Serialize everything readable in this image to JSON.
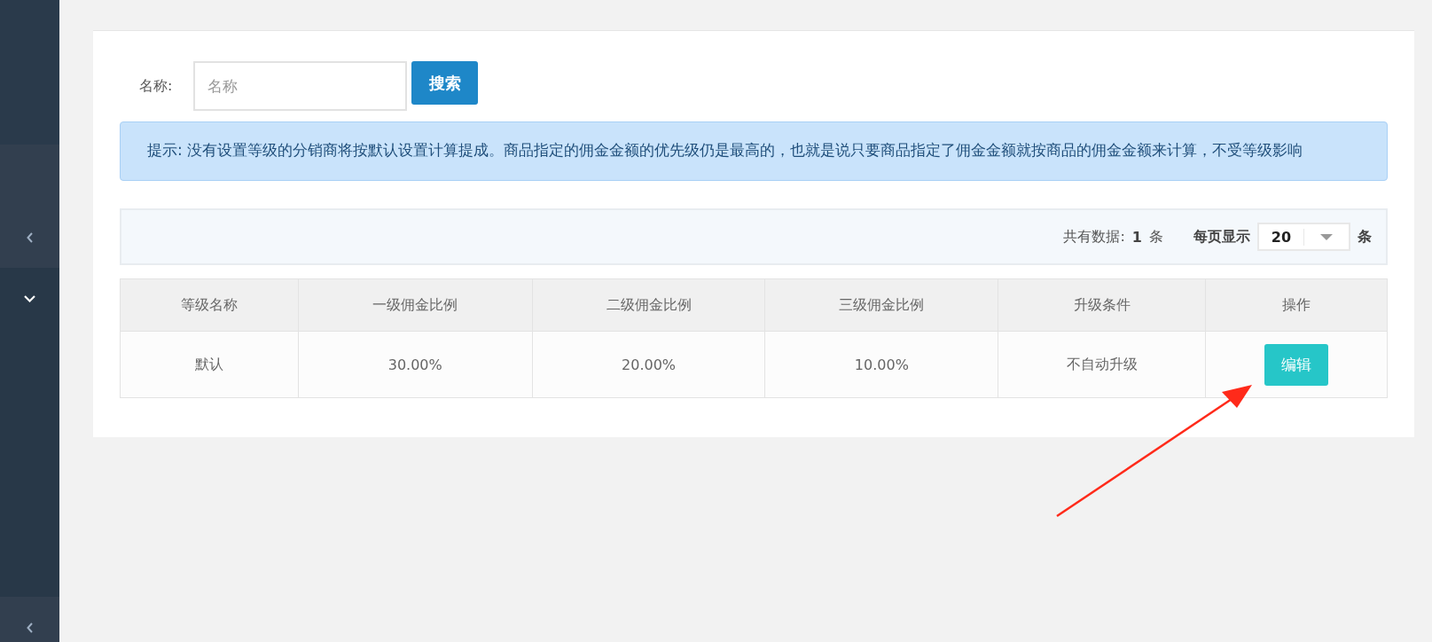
{
  "search": {
    "label": "名称:",
    "placeholder": "名称",
    "button": "搜索"
  },
  "notice": "提示: 没有设置等级的分销商将按默认设置计算提成。商品指定的佣金金额的优先级仍是最高的，也就是说只要商品指定了佣金金额就按商品的佣金金额来计算，不受等级影响",
  "pager": {
    "total_label": "共有数据:",
    "total": "1",
    "total_unit": "条",
    "page_size_label": "每页显示",
    "page_size": "20",
    "page_size_unit": "条"
  },
  "table": {
    "columns": [
      "等级名称",
      "一级佣金比例",
      "二级佣金比例",
      "三级佣金比例",
      "升级条件",
      "操作"
    ],
    "rows": [
      {
        "cells": [
          "默认",
          "30.00%",
          "20.00%",
          "10.00%",
          "不自动升级"
        ],
        "action": "编辑"
      }
    ]
  }
}
